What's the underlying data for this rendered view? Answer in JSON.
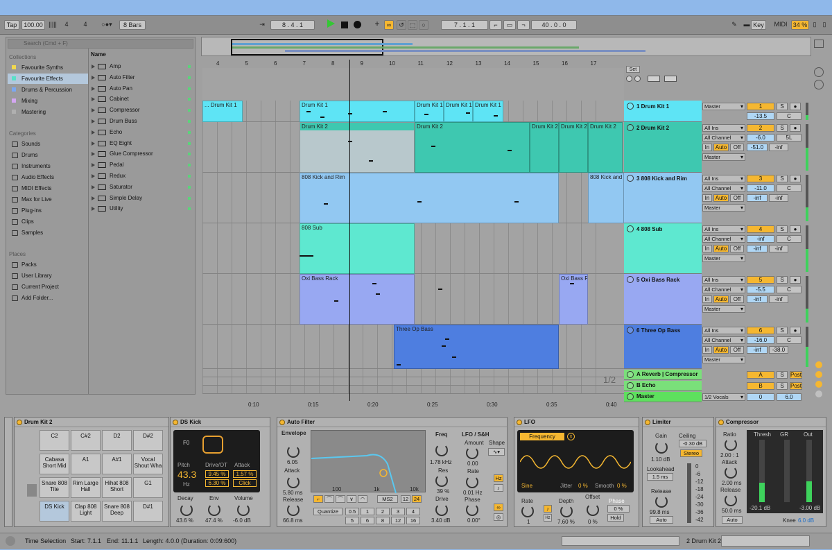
{
  "transport": {
    "tap": "Tap",
    "tempo": "100.00",
    "sig_num": "4",
    "sig_den": "4",
    "quant": "8 Bars",
    "pos": "8 .  4 .  1",
    "loop_start": "7 .  1 .  1",
    "loop_len": "40 .  0 .  0",
    "key": "Key",
    "midi": "MIDI",
    "cpu": "34 %"
  },
  "browser": {
    "search": "Search (Cmd + F)",
    "collections_h": "Collections",
    "collections": [
      {
        "label": "Favourite Synths",
        "color": "#f2d94e"
      },
      {
        "label": "Favourite Effects",
        "color": "#59e0c8"
      },
      {
        "label": "Drums & Percussion",
        "color": "#7ba8f2"
      },
      {
        "label": "Mixing",
        "color": "#d4a6f2"
      },
      {
        "label": "Mastering",
        "color": "#b0b0b0"
      }
    ],
    "categories_h": "Categories",
    "categories": [
      "Sounds",
      "Drums",
      "Instruments",
      "Audio Effects",
      "MIDI Effects",
      "Max for Live",
      "Plug-ins",
      "Clips",
      "Samples"
    ],
    "places_h": "Places",
    "places": [
      "Packs",
      "User Library",
      "Current Project",
      "Add Folder..."
    ],
    "name_h": "Name",
    "items": [
      "Amp",
      "Auto Filter",
      "Auto Pan",
      "Cabinet",
      "Compressor",
      "Drum Buss",
      "Echo",
      "EQ Eight",
      "Glue Compressor",
      "Pedal",
      "Redux",
      "Saturator",
      "Simple Delay",
      "Utility"
    ]
  },
  "ruler": [
    "4",
    "5",
    "6",
    "7",
    "8",
    "9",
    "10",
    "11",
    "12",
    "13",
    "14",
    "15",
    "16",
    "17"
  ],
  "times": [
    "0:10",
    "0:15",
    "0:20",
    "0:25",
    "0:30",
    "0:35",
    "0:40"
  ],
  "set_label": "Set",
  "zoom": "1/2",
  "clips": {
    "dk1": "Drum Kit 1",
    "dk1b": "... Drum Kit 1",
    "dk2": "Drum Kit 2",
    "kick": "808 Kick and Rim",
    "kickb": "808 Kick and",
    "sub": "808 Sub",
    "oxi": "Oxi Bass Rack",
    "oxib": "Oxi Bass R",
    "op": "Three Op Bass"
  },
  "tracks": [
    {
      "name": "1 Drum Kit 1",
      "num": "1",
      "vol": "-13.5",
      "pan": "C",
      "out": "Master",
      "color": "#5ee4f5"
    },
    {
      "name": "2 Drum Kit 2",
      "num": "2",
      "vol": "-6.0",
      "pan": "5L",
      "in": "All Ins",
      "ch": "All Channel",
      "send": "-51.0",
      "send2": "-inf",
      "out": "Master",
      "color": "#3ec8b0"
    },
    {
      "name": "3 808 Kick and Rim",
      "num": "3",
      "vol": "-11.0",
      "pan": "C",
      "in": "All Ins",
      "ch": "All Channel",
      "send": "-inf",
      "send2": "-inf",
      "out": "Master",
      "color": "#92c8f2"
    },
    {
      "name": "4 808 Sub",
      "num": "4",
      "vol": "-inf",
      "pan": "C",
      "in": "All Ins",
      "ch": "All Channel",
      "send": "-inf",
      "send2": "-inf",
      "out": "Master",
      "color": "#5ee8d0"
    },
    {
      "name": "5 Oxi Bass Rack",
      "num": "5",
      "vol": "-5.5",
      "pan": "C",
      "in": "All Ins",
      "ch": "All Channel",
      "send": "-inf",
      "send2": "-inf",
      "out": "Master",
      "color": "#98a8f2"
    },
    {
      "name": "6 Three Op Bass",
      "num": "6",
      "vol": "-16.0",
      "pan": "C",
      "in": "All Ins",
      "ch": "All Channel",
      "send": "-inf",
      "send2": "-38.0",
      "out": "Master",
      "color": "#4e7ee0"
    }
  ],
  "returns": [
    {
      "name": "A Reverb | Compressor",
      "btn": "A",
      "post": "Post"
    },
    {
      "name": "B Echo",
      "btn": "B",
      "post": "Post"
    }
  ],
  "master": {
    "name": "Master",
    "out": "1/2 Vocals",
    "vol": "0",
    "pan": "6.0"
  },
  "labels": {
    "in": "In",
    "auto": "Auto",
    "off": "Off",
    "s": "S"
  },
  "devices": {
    "drumrack": {
      "title": "Drum Kit 2",
      "pads": [
        "C2",
        "C#2",
        "D2",
        "D#2",
        "Cabasa Short Mid",
        "A1",
        "A#1",
        "Vocal Shout Wha",
        "Snare 808 Tite",
        "Rim Large Hall",
        "Hihat 808 Short",
        "G1",
        "DS Kick",
        "Clap 808 Light",
        "Snare 808 Deep",
        "D#1"
      ]
    },
    "dskick": {
      "title": "DS Kick",
      "note": "F0",
      "pitch_l": "Pitch",
      "pitch": "43.3",
      "hz": "Hz",
      "drive_l": "Drive/OT",
      "drive": "9.45 %",
      "ot": "6.30 %",
      "attack_l": "Attack",
      "attack": "1.57 %",
      "click": "Click",
      "decay_l": "Decay",
      "decay": "43.6 %",
      "env_l": "Env",
      "env": "47.4 %",
      "vol_l": "Volume",
      "vol": "-6.0 dB"
    },
    "autofilter": {
      "title": "Auto Filter",
      "env_l": "Envelope",
      "env": "6.05",
      "atk_l": "Attack",
      "atk": "5.80 ms",
      "rel_l": "Release",
      "rel": "66.8 ms",
      "freq_l": "Freq",
      "freq": "1.78 kHz",
      "res_l": "Res",
      "res": "39 %",
      "drive_l": "Drive",
      "drive": "3.40 dB",
      "lfo_l": "LFO / S&H",
      "amt_l": "Amount",
      "amt": "0.00",
      "rate_l": "Rate",
      "rate": "0.01 Hz",
      "phase_l": "Phase",
      "phase": "0.00°",
      "shape_l": "Shape",
      "hz": "Hz",
      "ax1": "100",
      "ax2": "1k",
      "ax3": "10k",
      "ms": "MS2",
      "n12": "12",
      "n24": "24",
      "quant": "Quantize",
      "q": [
        "0.5",
        "1",
        "2",
        "3",
        "4",
        "5",
        "6",
        "8",
        "12",
        "16"
      ]
    },
    "lfo": {
      "title": "LFO",
      "target": "Frequency",
      "wave": "Sine",
      "jitter_l": "Jitter",
      "jitter": "0 %",
      "smooth_l": "Smooth",
      "smooth": "0 %",
      "rate_l": "Rate",
      "rate": "1",
      "depth_l": "Depth",
      "depth": "7.60 %",
      "offset_l": "Offset",
      "offset": "0 %",
      "phase_l": "Phase",
      "phase": "0 %",
      "hold": "Hold",
      "hz": "Hz"
    },
    "limiter": {
      "title": "Limiter",
      "gain_l": "Gain",
      "gain": "1.10 dB",
      "ceil_l": "Ceiling",
      "ceil": "-0.30 dB",
      "stereo": "Stereo",
      "look_l": "Lookahead",
      "look": "1.5 ms",
      "rel_l": "Release",
      "rel": "99.8 ms",
      "auto": "Auto",
      "scale": [
        "0",
        "-6",
        "-12",
        "-18",
        "-24",
        "-30",
        "-36",
        "-42"
      ]
    },
    "compressor": {
      "title": "Compressor",
      "ratio_l": "Ratio",
      "ratio": "2.00 : 1",
      "atk_l": "Attack",
      "atk": "2.00 ms",
      "rel_l": "Release",
      "rel": "50.0 ms",
      "auto": "Auto",
      "thresh_l": "Thresh",
      "thresh": "-20.1 dB",
      "gr_l": "GR",
      "out_l": "Out",
      "out": "-3.00 dB",
      "knee_l": "Knee",
      "knee": "6.0 dB"
    }
  },
  "status": {
    "ts": "Time Selection",
    "start": "Start: 7.1.1",
    "end": "End: 11.1.1",
    "len": "Length: 4.0.0 (Duration: 0:09:600)",
    "track": "2 Drum Kit 2"
  }
}
